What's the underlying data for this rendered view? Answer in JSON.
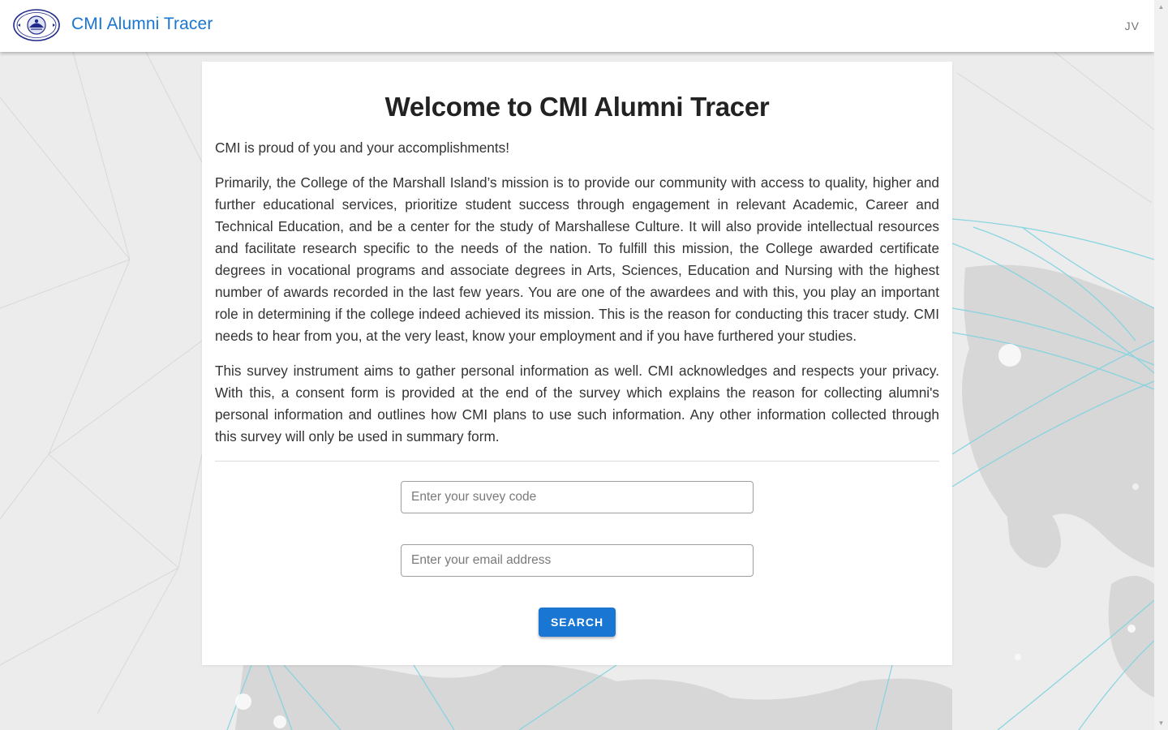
{
  "appbar": {
    "title": "CMI Alumni Tracer",
    "user_initials": "JV"
  },
  "card": {
    "heading": "Welcome to CMI Alumni Tracer",
    "intro": "CMI is proud of you and your accomplishments!",
    "mission": "Primarily, the College of the Marshall Island’s mission is to provide our community with access to quality, higher and further educational services, prioritize student success through engagement in relevant Academic, Career and Technical Education, and be a center for the study of Marshallese Culture. It will also provide intellectual resources and facilitate research specific to the needs of the nation. To fulfill this mission, the College awarded certificate degrees in vocational programs and associate degrees in Arts, Sciences, Education and Nursing with the highest number of awards recorded in the last few years. You are one of the awardees and with this, you play an important role in determining if the college indeed achieved its mission. This is the reason for conducting this tracer study. CMI needs to hear from you, at the very least, know your employment and if you have furthered your studies.",
    "privacy": "This survey instrument aims to gather personal information as well. CMI acknowledges and respects your privacy. With this, a consent form is provided at the end of the survey which explains the reason for collecting alumni's personal information and outlines how CMI plans to use such information. Any other information collected through this survey will only be used in summary form."
  },
  "form": {
    "survey_code": {
      "value": "",
      "placeholder": "Enter your suvey code"
    },
    "email": {
      "value": "",
      "placeholder": "Enter your email address"
    },
    "search_label": "SEARCH"
  },
  "colors": {
    "accent": "#1976d2",
    "background": "#ececec"
  },
  "icons": {
    "logo": "cmi-seal-logo"
  }
}
